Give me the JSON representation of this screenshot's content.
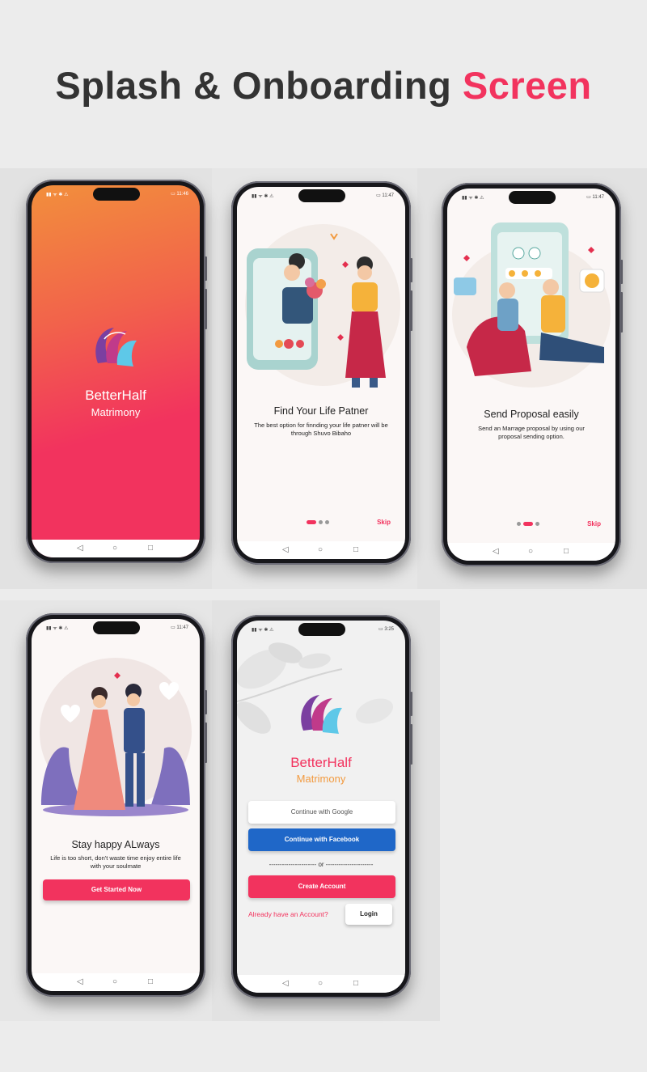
{
  "header": {
    "title_dark": "Splash & Onboarding",
    "title_accent": "Screen"
  },
  "colors": {
    "accent": "#f2335e",
    "facebook": "#1f67c8",
    "orange": "#f29a3f"
  },
  "splash": {
    "time": "11:46",
    "app_name": "BetterHalf",
    "tagline": "Matrimony"
  },
  "onboard1": {
    "time": "11:47",
    "title": "Find Your Life Patner",
    "desc_line1": "The best option for finnding your life patner will be",
    "desc_line2": "through Shuvo Bibaho",
    "skip": "Skip"
  },
  "onboard2": {
    "time": "11:47",
    "title": "Send Proposal easily",
    "desc_line1": "Send an Marrage proposal by using our",
    "desc_line2": "proposal sending option.",
    "skip": "Skip"
  },
  "onboard3": {
    "time": "11:47",
    "title": "Stay happy ALways",
    "desc_line1": "Life is too short, don't waste time enjoy entire life",
    "desc_line2": "with your soulmate",
    "button": "Get Started Now"
  },
  "login": {
    "time": "3:25",
    "app_name": "BetterHalf",
    "tagline": "Matrimony",
    "google_button": "Continue with Google",
    "facebook_button": "Continue with Facebook",
    "divider": "---------------------- or ----------------------",
    "create_button": "Create Account",
    "have_account": "Already have an Account?",
    "login_button": "Login"
  },
  "nav_icons": [
    "back-icon",
    "home-icon",
    "recents-icon"
  ]
}
